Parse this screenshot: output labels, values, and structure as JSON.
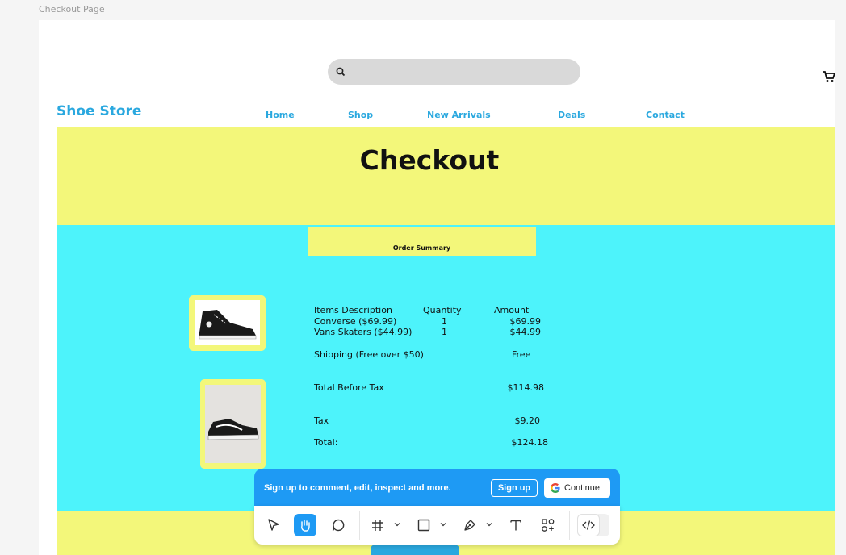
{
  "frame_label": "Checkout Page",
  "brand": "Shoe Store",
  "nav": [
    "Home",
    "Shop",
    "New Arrivals",
    "Deals",
    "Contact"
  ],
  "hero_title": "Checkout",
  "order_summary_title": "Order Summary",
  "table": {
    "headers": {
      "description": "Items Description",
      "quantity": "Quantity",
      "amount": "Amount"
    },
    "rows": [
      {
        "description": "Converse ($69.99)",
        "quantity": "1",
        "amount": "$69.99"
      },
      {
        "description": "Vans Skaters ($44.99)",
        "quantity": "1",
        "amount": "$44.99"
      }
    ],
    "shipping": {
      "label": "Shipping (Free over $50)",
      "value": "Free"
    },
    "total_before_tax": {
      "label": "Total Before Tax",
      "value": "$114.98"
    },
    "tax": {
      "label": "Tax",
      "value": "$9.20"
    },
    "total": {
      "label": "Total:",
      "value": "$124.18"
    }
  },
  "banner": {
    "text": "Sign up to comment, edit, inspect and more.",
    "signup": "Sign up",
    "continue": "Continue"
  },
  "toolbar_tools": [
    "move-tool",
    "hand-tool",
    "comment-tool",
    "frame-tool",
    "shape-tool",
    "pen-tool",
    "text-tool",
    "components-tool",
    "dev-mode-toggle"
  ],
  "colors": {
    "accent": "#2aa8df",
    "hero": "#f3f77a",
    "main": "#4df3fb",
    "banner": "#1e9af4"
  }
}
